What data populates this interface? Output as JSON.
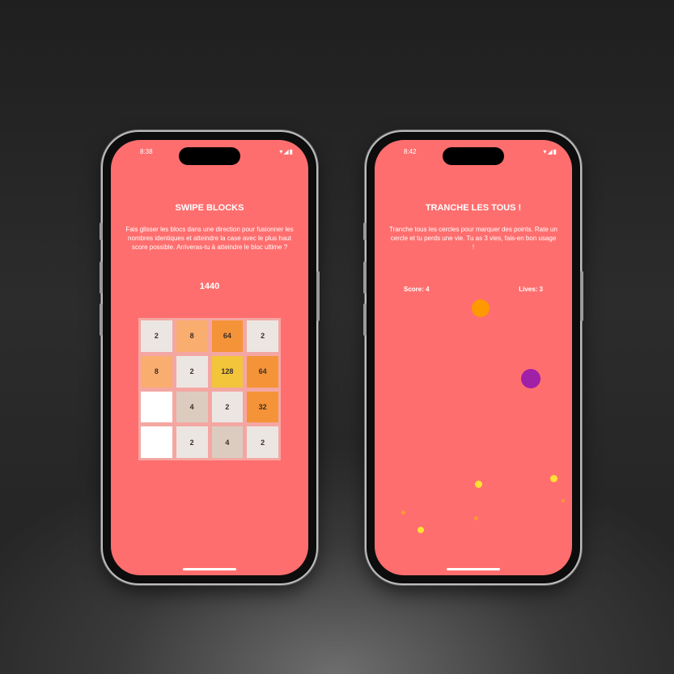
{
  "phone_left": {
    "status_time": "8:38",
    "title": "SWIPE BLOCKS",
    "description": "Fais glisser les blocs dans une direction pour fusionner les nombres identiques et atteindre la case avec le plus haut score possible. Arriveras-tu à atteindre le bloc ultime ?",
    "score": "1440",
    "grid": [
      {
        "value": "2",
        "color": "#ece6e2"
      },
      {
        "value": "8",
        "color": "#f9ad6f"
      },
      {
        "value": "64",
        "color": "#f59338"
      },
      {
        "value": "2",
        "color": "#ece6e2"
      },
      {
        "value": "8",
        "color": "#f9ad6f"
      },
      {
        "value": "2",
        "color": "#ece6e2"
      },
      {
        "value": "128",
        "color": "#f2c53b"
      },
      {
        "value": "64",
        "color": "#f59338"
      },
      {
        "value": "",
        "color": "#ffffff"
      },
      {
        "value": "4",
        "color": "#dcccc0"
      },
      {
        "value": "2",
        "color": "#ece6e2"
      },
      {
        "value": "32",
        "color": "#f59338"
      },
      {
        "value": "",
        "color": "#ffffff"
      },
      {
        "value": "2",
        "color": "#ece6e2"
      },
      {
        "value": "4",
        "color": "#dcccc0"
      },
      {
        "value": "2",
        "color": "#ece6e2"
      }
    ]
  },
  "phone_right": {
    "status_time": "8:42",
    "title": "TRANCHE LES TOUS !",
    "description": "Tranche tous les cercles pour marquer des points. Rate un cercle et tu perds une vie. Tu as 3 vies, fais-en bon usage !",
    "score_label": "Score: 4",
    "lives_label": "Lives: 3",
    "circle_colors": {
      "orange": "#ff9900",
      "purple": "#a020a8",
      "yellow": "#ffe033",
      "spark": "#ff9a33"
    }
  },
  "status_icons": "▾◢▮",
  "colors": {
    "screen": "#ff6e6e",
    "grid_bg": "#f4a7a2"
  }
}
